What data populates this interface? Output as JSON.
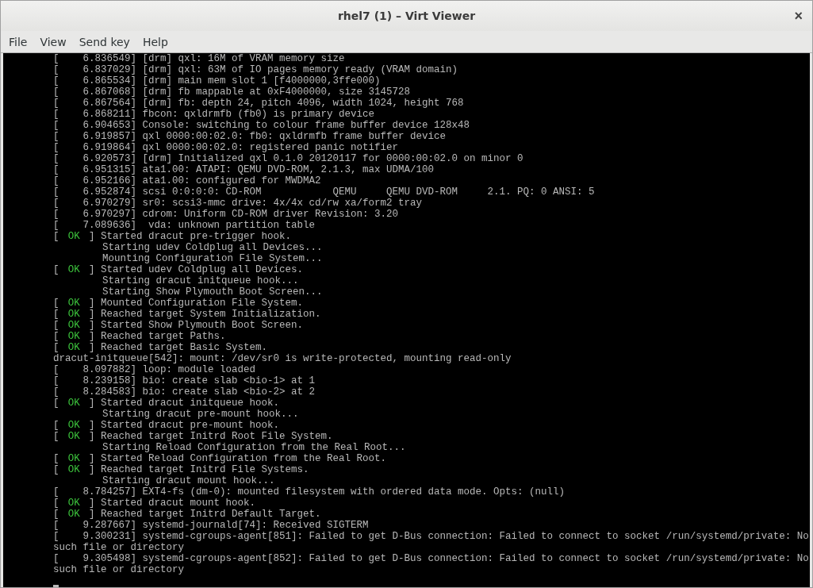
{
  "window": {
    "title": "rhel7 (1) – Virt Viewer",
    "close": "×"
  },
  "menu": [
    "File",
    "View",
    "Send key",
    "Help"
  ],
  "console": {
    "lines": [
      {
        "kind": "kernel",
        "text": "[    6.836549] [drm] qxl: 16M of VRAM memory size"
      },
      {
        "kind": "kernel",
        "text": "[    6.837029] [drm] qxl: 63M of IO pages memory ready (VRAM domain)"
      },
      {
        "kind": "kernel",
        "text": "[    6.865534] [drm] main mem slot 1 [f4000000,3ffe000)"
      },
      {
        "kind": "kernel",
        "text": "[    6.867068] [drm] fb mappable at 0xF4000000, size 3145728"
      },
      {
        "kind": "kernel",
        "text": "[    6.867564] [drm] fb: depth 24, pitch 4096, width 1024, height 768"
      },
      {
        "kind": "kernel",
        "text": "[    6.868211] fbcon: qxldrmfb (fb0) is primary device"
      },
      {
        "kind": "kernel",
        "text": "[    6.904653] Console: switching to colour frame buffer device 128x48"
      },
      {
        "kind": "kernel",
        "text": "[    6.919857] qxl 0000:00:02.0: fb0: qxldrmfb frame buffer device"
      },
      {
        "kind": "kernel",
        "text": "[    6.919864] qxl 0000:00:02.0: registered panic notifier"
      },
      {
        "kind": "kernel",
        "text": "[    6.920573] [drm] Initialized qxl 0.1.0 20120117 for 0000:00:02.0 on minor 0"
      },
      {
        "kind": "kernel",
        "text": "[    6.951315] ata1.00: ATAPI: QEMU DVD-ROM, 2.1.3, max UDMA/100"
      },
      {
        "kind": "kernel",
        "text": "[    6.952166] ata1.00: configured for MWDMA2"
      },
      {
        "kind": "kernel",
        "text": "[    6.952874] scsi 0:0:0:0: CD-ROM            QEMU     QEMU DVD-ROM     2.1. PQ: 0 ANSI: 5"
      },
      {
        "kind": "kernel",
        "text": "[    6.970279] sr0: scsi3-mmc drive: 4x/4x cd/rw xa/form2 tray"
      },
      {
        "kind": "kernel",
        "text": "[    6.970297] cdrom: Uniform CD-ROM driver Revision: 3.20"
      },
      {
        "kind": "kernel",
        "text": "[    7.089636]  vda: unknown partition table"
      },
      {
        "kind": "status",
        "left": "[",
        "status": "OK",
        "right": "]",
        "text": "Started dracut pre-trigger hook."
      },
      {
        "kind": "job",
        "text": "Starting udev Coldplug all Devices..."
      },
      {
        "kind": "job",
        "text": "Mounting Configuration File System..."
      },
      {
        "kind": "status",
        "left": "[",
        "status": "OK",
        "right": "]",
        "text": "Started udev Coldplug all Devices."
      },
      {
        "kind": "job",
        "text": "Starting dracut initqueue hook..."
      },
      {
        "kind": "job",
        "text": "Starting Show Plymouth Boot Screen..."
      },
      {
        "kind": "status",
        "left": "[",
        "status": "OK",
        "right": "]",
        "text": "Mounted Configuration File System."
      },
      {
        "kind": "status",
        "left": "[",
        "status": "OK",
        "right": "]",
        "text": "Reached target System Initialization."
      },
      {
        "kind": "status",
        "left": "[",
        "status": "OK",
        "right": "]",
        "text": "Started Show Plymouth Boot Screen."
      },
      {
        "kind": "status",
        "left": "[",
        "status": "OK",
        "right": "]",
        "text": "Reached target Paths."
      },
      {
        "kind": "status",
        "left": "[",
        "status": "OK",
        "right": "]",
        "text": "Reached target Basic System."
      },
      {
        "kind": "kernel",
        "text": "dracut-initqueue[542]: mount: /dev/sr0 is write-protected, mounting read-only"
      },
      {
        "kind": "kernel",
        "text": "[    8.097882] loop: module loaded"
      },
      {
        "kind": "kernel",
        "text": "[    8.239158] bio: create slab <bio-1> at 1"
      },
      {
        "kind": "kernel",
        "text": "[    8.284583] bio: create slab <bio-2> at 2"
      },
      {
        "kind": "status",
        "left": "[",
        "status": "OK",
        "right": "]",
        "text": "Started dracut initqueue hook."
      },
      {
        "kind": "job",
        "text": "Starting dracut pre-mount hook..."
      },
      {
        "kind": "status",
        "left": "[",
        "status": "OK",
        "right": "]",
        "text": "Started dracut pre-mount hook."
      },
      {
        "kind": "status",
        "left": "[",
        "status": "OK",
        "right": "]",
        "text": "Reached target Initrd Root File System."
      },
      {
        "kind": "job",
        "text": "Starting Reload Configuration from the Real Root..."
      },
      {
        "kind": "status",
        "left": "[",
        "status": "OK",
        "right": "]",
        "text": "Started Reload Configuration from the Real Root."
      },
      {
        "kind": "status",
        "left": "[",
        "status": "OK",
        "right": "]",
        "text": "Reached target Initrd File Systems."
      },
      {
        "kind": "job",
        "text": "Starting dracut mount hook..."
      },
      {
        "kind": "kernel",
        "text": "[    8.784257] EXT4-fs (dm-0): mounted filesystem with ordered data mode. Opts: (null)"
      },
      {
        "kind": "status",
        "left": "[",
        "status": "OK",
        "right": "]",
        "text": "Started dracut mount hook."
      },
      {
        "kind": "status",
        "left": "[",
        "status": "OK",
        "right": "]",
        "text": "Reached target Initrd Default Target."
      },
      {
        "kind": "kernel",
        "text": "[    9.287667] systemd-journald[74]: Received SIGTERM"
      },
      {
        "kind": "kernel",
        "text": "[    9.300231] systemd-cgroups-agent[851]: Failed to get D-Bus connection: Failed to connect to socket /run/systemd/private: No"
      },
      {
        "kind": "kernel",
        "text": "such file or directory"
      },
      {
        "kind": "kernel",
        "text": "[    9.305498] systemd-cgroups-agent[852]: Failed to get D-Bus connection: Failed to connect to socket /run/systemd/private: No"
      },
      {
        "kind": "kernel",
        "text": "such file or directory"
      }
    ]
  }
}
